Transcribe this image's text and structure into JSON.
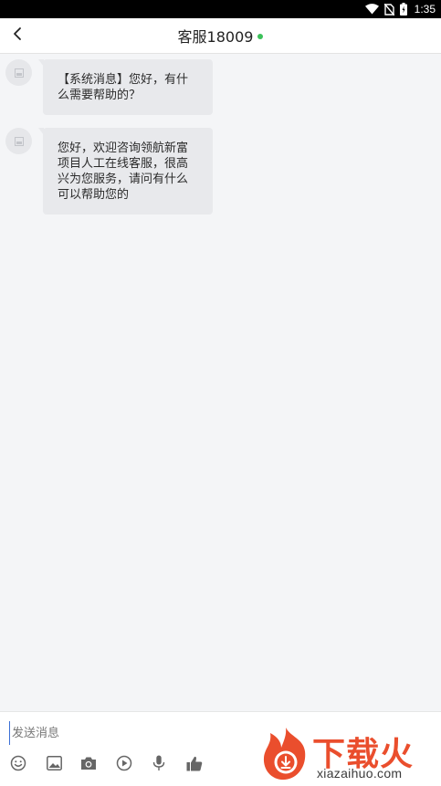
{
  "status_bar": {
    "time": "1:35",
    "icons": [
      "wifi-icon",
      "no-sim-icon",
      "battery-icon"
    ]
  },
  "header": {
    "back_icon": "chevron-left-icon",
    "title": "客服18009",
    "online_status_color": "#3bc15a"
  },
  "messages": [
    {
      "sender": "system",
      "avatar_icon": "image-placeholder-icon",
      "text": "【系统消息】您好，有什\n么需要帮助的？"
    },
    {
      "sender": "agent",
      "avatar_icon": "image-placeholder-icon",
      "text": "您好，欢迎咨询领航新富\n项目人工在线客服，很高\n兴为您服务，请问有什么\n可以帮助您的"
    }
  ],
  "composer": {
    "placeholder": "发送消息",
    "value": ""
  },
  "toolbar": {
    "items": [
      "emoji-icon",
      "image-icon",
      "camera-icon",
      "video-icon",
      "microphone-icon",
      "thumbs-up-icon"
    ]
  },
  "watermark": {
    "brand": "下载火",
    "domain": "xiazaihuo.com",
    "color": "#ea4e2d"
  }
}
